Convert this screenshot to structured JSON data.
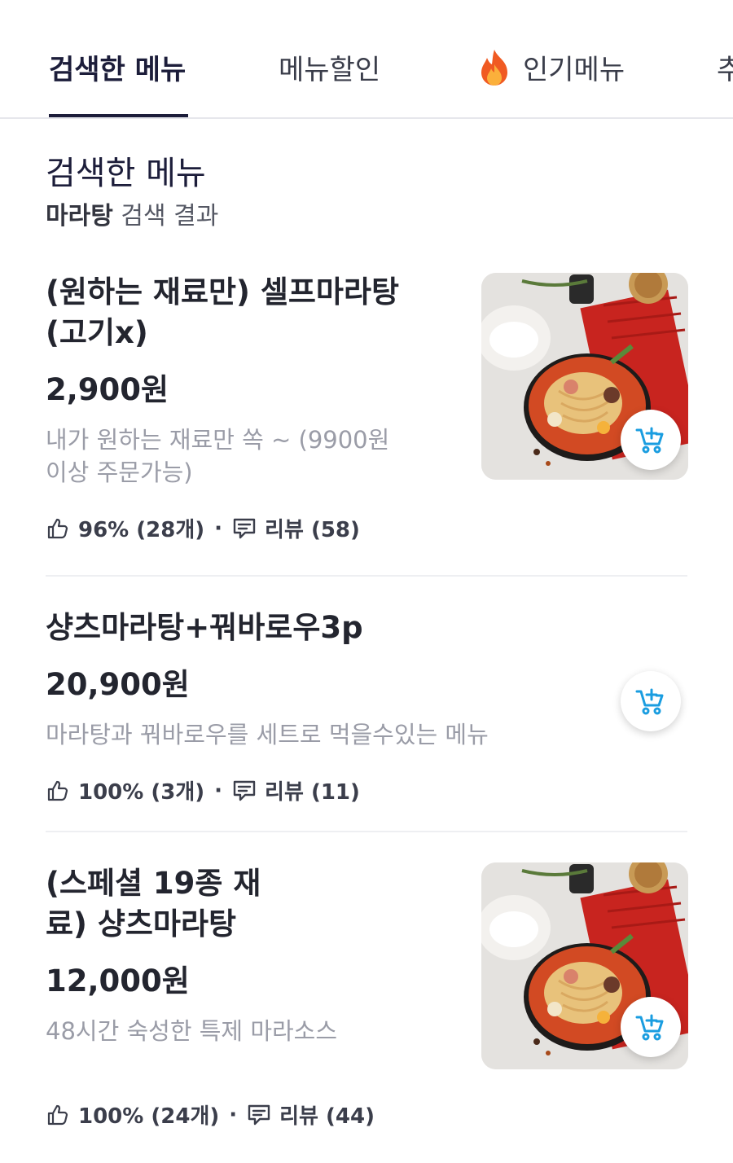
{
  "tabs": [
    {
      "label": "검색한 메뉴",
      "active": true
    },
    {
      "label": "메뉴할인",
      "active": false
    },
    {
      "label": "인기메뉴",
      "icon": "fire-icon",
      "active": false
    },
    {
      "label": "추",
      "active": false
    }
  ],
  "section": {
    "title": "검색한 메뉴",
    "keyword": "마라탕",
    "suffix": "검색 결과"
  },
  "items": [
    {
      "name": "(원하는 재료만) 셀프마라탕 (고기x)",
      "price": "2,900원",
      "description": "내가 원하는 재료만 쏙 ~ (9900원 이상 주문가능)",
      "like": "96% (28개)",
      "review": "리뷰 (58)",
      "has_image": true
    },
    {
      "name": "샹츠마라탕+꿔바로우3p",
      "price": "20,900원",
      "description": "마라탕과 꿔바로우를 세트로 먹을수있는 메뉴",
      "like": "100% (3개)",
      "review": "리뷰 (11)",
      "has_image": false
    },
    {
      "name": "(스페셜 19종 재료) 샹츠마라탕",
      "price": "12,000원",
      "description": "48시간 숙성한 특제 마라소스",
      "like": "100% (24개)",
      "review": "리뷰 (44)",
      "has_image": true
    }
  ],
  "colors": {
    "accent_cart": "#1a9de0",
    "active_tab": "#1c1d3a",
    "muted_text": "#9a9ca7"
  }
}
